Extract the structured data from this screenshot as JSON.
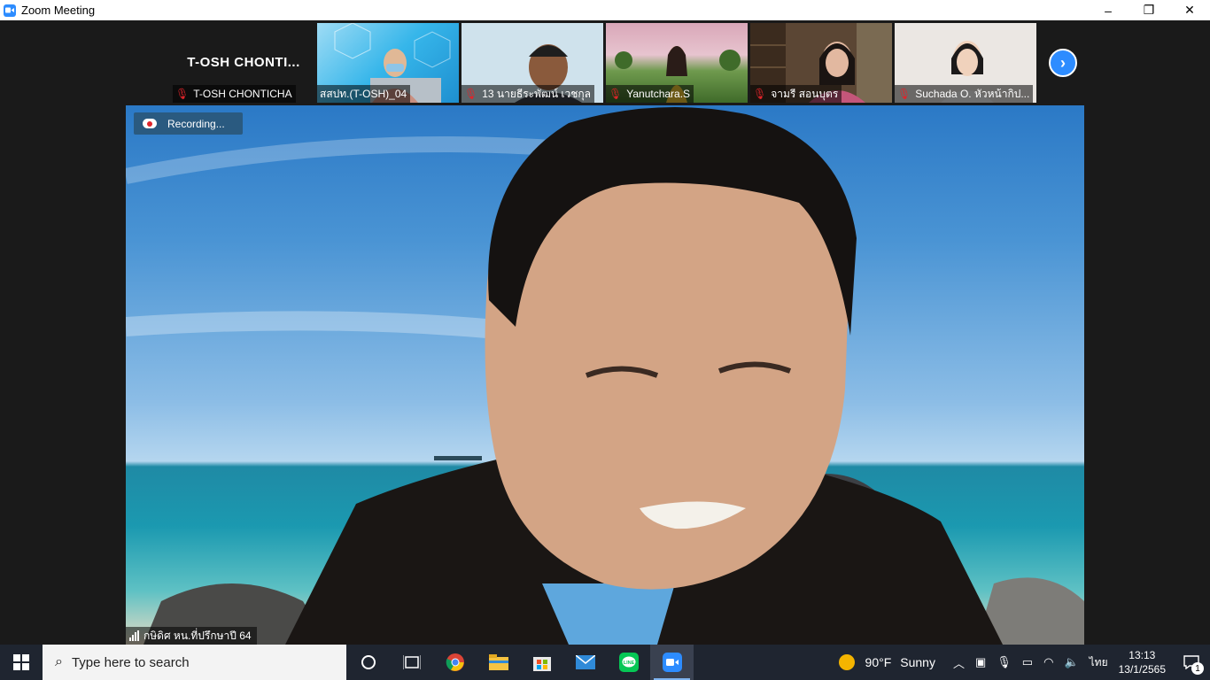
{
  "window": {
    "title": "Zoom Meeting",
    "controls": [
      "–",
      "❐",
      "✕"
    ]
  },
  "gallery_strip": {
    "tiles": [
      {
        "big_name": "T-OSH CHONTI...",
        "label": "T-OSH CHONTICHA",
        "muted": true,
        "video": false
      },
      {
        "label": "สสปท.(T-OSH)_04",
        "muted": false,
        "video": true
      },
      {
        "label": "13 นายธีระพัฒน์ เวชกุล",
        "muted": true,
        "video": true
      },
      {
        "label": "Yanutchara.S",
        "muted": true,
        "video": true
      },
      {
        "label": "จามรี สอนบุตร",
        "muted": true,
        "video": true
      },
      {
        "label": "Suchada O. หัวหน้ากิป...",
        "muted": true,
        "video": true
      }
    ],
    "next_page_icon": "chevron-right-icon"
  },
  "main_video": {
    "recording_label": "Recording...",
    "speaker_name": "กษิดิศ  หน.ที่ปรึกษาปี 64"
  },
  "taskbar": {
    "search_placeholder": "Type here to search",
    "apps": [
      "cortana-icon",
      "task-view-icon",
      "chrome-icon",
      "file-explorer-icon",
      "microsoft-store-icon",
      "mail-icon",
      "line-icon",
      "zoom-icon"
    ],
    "weather": {
      "temp": "90°F",
      "condition": "Sunny"
    },
    "language": "ไทย",
    "time": "13:13",
    "date": "13/1/2565",
    "notification_count": "1"
  },
  "colors": {
    "zoom_blue": "#2d8cff",
    "muted_red": "#e0242a",
    "taskbar": "#1f2530"
  }
}
